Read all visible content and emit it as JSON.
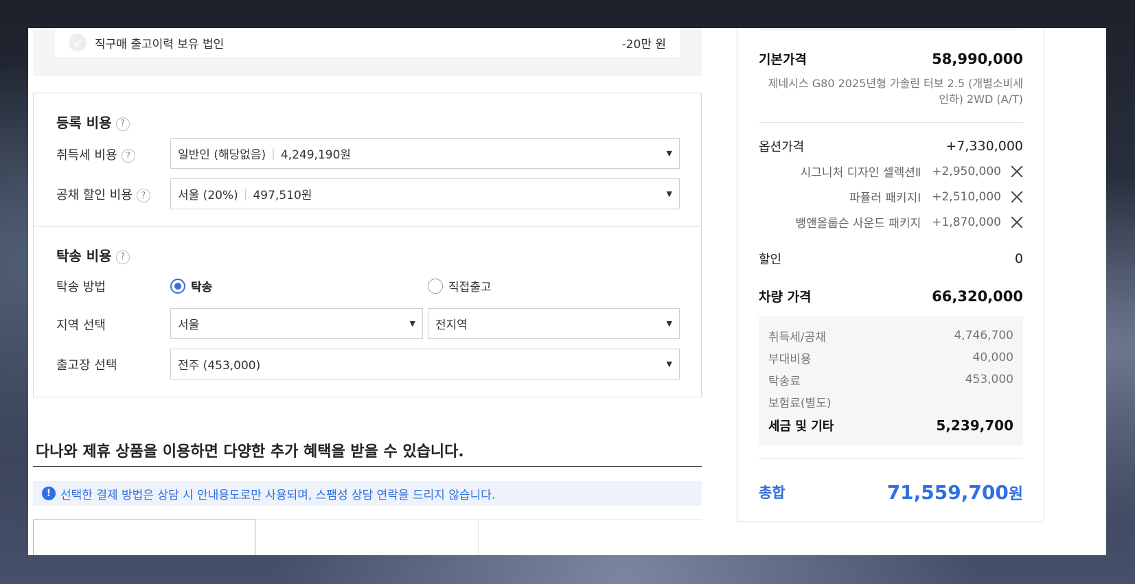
{
  "discount_item": {
    "label": "직구매 출고이력 보유 법인",
    "value": "-20만 원"
  },
  "registration": {
    "title": "등록 비용",
    "help": "?",
    "acquisition_tax": {
      "label": "취득세 비용",
      "selected": "일반인 (해당없음)",
      "amount": "4,249,190원"
    },
    "bond_discount": {
      "label": "공채 할인 비용",
      "selected": "서울 (20%)",
      "amount": "497,510원"
    }
  },
  "delivery": {
    "title": "탁송 비용",
    "help": "?",
    "method": {
      "label": "탁송 방법",
      "options": [
        "탁송",
        "직접출고"
      ],
      "selected": "탁송"
    },
    "region": {
      "label": "지역 선택",
      "city": "서울",
      "district": "전지역"
    },
    "depot": {
      "label": "출고장 선택",
      "selected": "전주 (453,000)"
    }
  },
  "partner": {
    "heading": "다나와 제휴 상품을 이용하면 다양한 추가 혜택을 받을 수 있습니다.",
    "notice": "선택한 결제 방법은 상담 시 안내용도로만 사용되며, 스팸성 상담 연락을 드리지 않습니다."
  },
  "summary": {
    "base_price": {
      "label": "기본가격",
      "value": "58,990,000",
      "desc": "제네시스 G80 2025년형 가솔린 터보 2.5 (개별소비세 인하) 2WD (A/T)"
    },
    "option_price": {
      "label": "옵션가격",
      "value": "+7,330,000"
    },
    "options": [
      {
        "name": "시그니처 디자인 셀렉션Ⅱ",
        "price": "+2,950,000"
      },
      {
        "name": "파퓰러 패키지Ⅰ",
        "price": "+2,510,000"
      },
      {
        "name": "뱅앤올룹슨 사운드 패키지",
        "price": "+1,870,000"
      }
    ],
    "discount": {
      "label": "할인",
      "value": "0"
    },
    "vehicle_price": {
      "label": "차량 가격",
      "value": "66,320,000"
    },
    "taxes": [
      {
        "label": "취득세/공채",
        "value": "4,746,700"
      },
      {
        "label": "부대비용",
        "value": "40,000"
      },
      {
        "label": "탁송료",
        "value": "453,000"
      },
      {
        "label": "보험료(별도)",
        "value": ""
      }
    ],
    "tax_total": {
      "label": "세금 및 기타",
      "value": "5,239,700"
    },
    "total": {
      "label": "총합",
      "value": "71,559,700",
      "unit": "원"
    }
  },
  "colors": {
    "accent": "#2f6fe0",
    "notice_bg": "#eef3fb"
  }
}
